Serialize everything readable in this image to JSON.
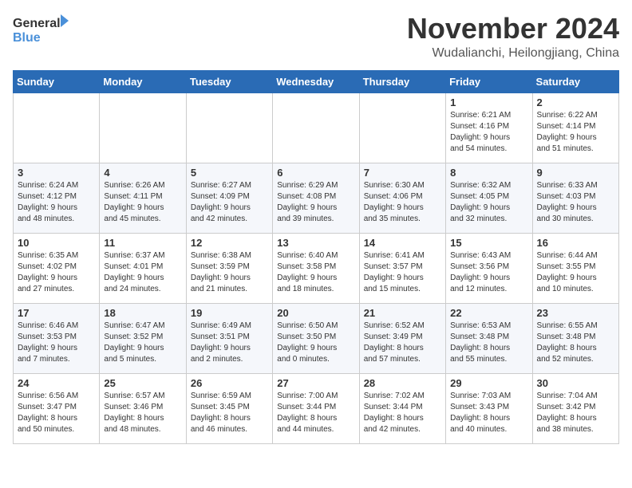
{
  "logo": {
    "general": "General",
    "blue": "Blue"
  },
  "title": {
    "month": "November 2024",
    "location": "Wudalianchi, Heilongjiang, China"
  },
  "weekdays": [
    "Sunday",
    "Monday",
    "Tuesday",
    "Wednesday",
    "Thursday",
    "Friday",
    "Saturday"
  ],
  "weeks": [
    [
      {
        "day": "",
        "info": ""
      },
      {
        "day": "",
        "info": ""
      },
      {
        "day": "",
        "info": ""
      },
      {
        "day": "",
        "info": ""
      },
      {
        "day": "",
        "info": ""
      },
      {
        "day": "1",
        "info": "Sunrise: 6:21 AM\nSunset: 4:16 PM\nDaylight: 9 hours\nand 54 minutes."
      },
      {
        "day": "2",
        "info": "Sunrise: 6:22 AM\nSunset: 4:14 PM\nDaylight: 9 hours\nand 51 minutes."
      }
    ],
    [
      {
        "day": "3",
        "info": "Sunrise: 6:24 AM\nSunset: 4:12 PM\nDaylight: 9 hours\nand 48 minutes."
      },
      {
        "day": "4",
        "info": "Sunrise: 6:26 AM\nSunset: 4:11 PM\nDaylight: 9 hours\nand 45 minutes."
      },
      {
        "day": "5",
        "info": "Sunrise: 6:27 AM\nSunset: 4:09 PM\nDaylight: 9 hours\nand 42 minutes."
      },
      {
        "day": "6",
        "info": "Sunrise: 6:29 AM\nSunset: 4:08 PM\nDaylight: 9 hours\nand 39 minutes."
      },
      {
        "day": "7",
        "info": "Sunrise: 6:30 AM\nSunset: 4:06 PM\nDaylight: 9 hours\nand 35 minutes."
      },
      {
        "day": "8",
        "info": "Sunrise: 6:32 AM\nSunset: 4:05 PM\nDaylight: 9 hours\nand 32 minutes."
      },
      {
        "day": "9",
        "info": "Sunrise: 6:33 AM\nSunset: 4:03 PM\nDaylight: 9 hours\nand 30 minutes."
      }
    ],
    [
      {
        "day": "10",
        "info": "Sunrise: 6:35 AM\nSunset: 4:02 PM\nDaylight: 9 hours\nand 27 minutes."
      },
      {
        "day": "11",
        "info": "Sunrise: 6:37 AM\nSunset: 4:01 PM\nDaylight: 9 hours\nand 24 minutes."
      },
      {
        "day": "12",
        "info": "Sunrise: 6:38 AM\nSunset: 3:59 PM\nDaylight: 9 hours\nand 21 minutes."
      },
      {
        "day": "13",
        "info": "Sunrise: 6:40 AM\nSunset: 3:58 PM\nDaylight: 9 hours\nand 18 minutes."
      },
      {
        "day": "14",
        "info": "Sunrise: 6:41 AM\nSunset: 3:57 PM\nDaylight: 9 hours\nand 15 minutes."
      },
      {
        "day": "15",
        "info": "Sunrise: 6:43 AM\nSunset: 3:56 PM\nDaylight: 9 hours\nand 12 minutes."
      },
      {
        "day": "16",
        "info": "Sunrise: 6:44 AM\nSunset: 3:55 PM\nDaylight: 9 hours\nand 10 minutes."
      }
    ],
    [
      {
        "day": "17",
        "info": "Sunrise: 6:46 AM\nSunset: 3:53 PM\nDaylight: 9 hours\nand 7 minutes."
      },
      {
        "day": "18",
        "info": "Sunrise: 6:47 AM\nSunset: 3:52 PM\nDaylight: 9 hours\nand 5 minutes."
      },
      {
        "day": "19",
        "info": "Sunrise: 6:49 AM\nSunset: 3:51 PM\nDaylight: 9 hours\nand 2 minutes."
      },
      {
        "day": "20",
        "info": "Sunrise: 6:50 AM\nSunset: 3:50 PM\nDaylight: 9 hours\nand 0 minutes."
      },
      {
        "day": "21",
        "info": "Sunrise: 6:52 AM\nSunset: 3:49 PM\nDaylight: 8 hours\nand 57 minutes."
      },
      {
        "day": "22",
        "info": "Sunrise: 6:53 AM\nSunset: 3:48 PM\nDaylight: 8 hours\nand 55 minutes."
      },
      {
        "day": "23",
        "info": "Sunrise: 6:55 AM\nSunset: 3:48 PM\nDaylight: 8 hours\nand 52 minutes."
      }
    ],
    [
      {
        "day": "24",
        "info": "Sunrise: 6:56 AM\nSunset: 3:47 PM\nDaylight: 8 hours\nand 50 minutes."
      },
      {
        "day": "25",
        "info": "Sunrise: 6:57 AM\nSunset: 3:46 PM\nDaylight: 8 hours\nand 48 minutes."
      },
      {
        "day": "26",
        "info": "Sunrise: 6:59 AM\nSunset: 3:45 PM\nDaylight: 8 hours\nand 46 minutes."
      },
      {
        "day": "27",
        "info": "Sunrise: 7:00 AM\nSunset: 3:44 PM\nDaylight: 8 hours\nand 44 minutes."
      },
      {
        "day": "28",
        "info": "Sunrise: 7:02 AM\nSunset: 3:44 PM\nDaylight: 8 hours\nand 42 minutes."
      },
      {
        "day": "29",
        "info": "Sunrise: 7:03 AM\nSunset: 3:43 PM\nDaylight: 8 hours\nand 40 minutes."
      },
      {
        "day": "30",
        "info": "Sunrise: 7:04 AM\nSunset: 3:42 PM\nDaylight: 8 hours\nand 38 minutes."
      }
    ]
  ]
}
